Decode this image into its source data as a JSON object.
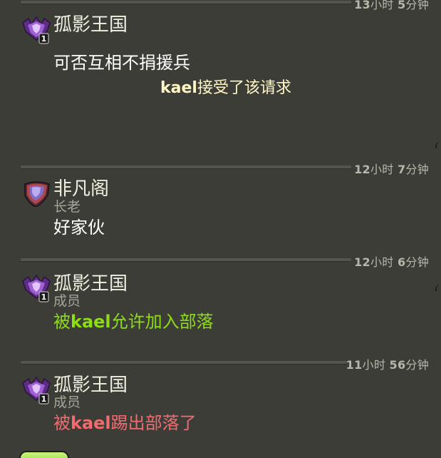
{
  "entries": [
    {
      "time": {
        "h": "13",
        "h_unit": "小时",
        "m": "5",
        "m_unit": "分钟"
      },
      "author": {
        "name": "孤影王国",
        "role": "",
        "league_level": "1",
        "badge": "purple-crown-league-icon"
      },
      "message": "可否互相不捐援兵",
      "system": {
        "actor": "kael",
        "action": "接受了该请求"
      }
    },
    {
      "time": {
        "h": "12",
        "h_unit": "小时",
        "m": "7",
        "m_unit": "分钟"
      },
      "author": {
        "name": "非凡阁",
        "role": "长老",
        "badge": "red-shield-badge-icon"
      },
      "message": "好家伙"
    },
    {
      "time": {
        "h": "12",
        "h_unit": "小时",
        "m": "6",
        "m_unit": "分钟"
      },
      "author": {
        "name": "孤影王国",
        "role": "成员",
        "league_level": "1",
        "badge": "purple-crown-league-icon"
      },
      "message_event": {
        "prefix": "被",
        "actor": "kael",
        "suffix": "允许加入部落"
      }
    },
    {
      "time": {
        "h": "11",
        "h_unit": "小时",
        "m": "56",
        "m_unit": "分钟"
      },
      "author": {
        "name": "孤影王国",
        "role": "成员",
        "league_level": "1",
        "badge": "purple-crown-league-icon"
      },
      "message_event": {
        "prefix": "被",
        "actor": "kael",
        "suffix": "踢出部落了"
      }
    }
  ],
  "colors": {
    "background": "#3d3d38",
    "name_text": "#f0f0e0",
    "role_text": "#a6a69a",
    "join_event": "#8cdc18",
    "kick_event": "#ef6c70",
    "system_text": "#fff6c6"
  }
}
